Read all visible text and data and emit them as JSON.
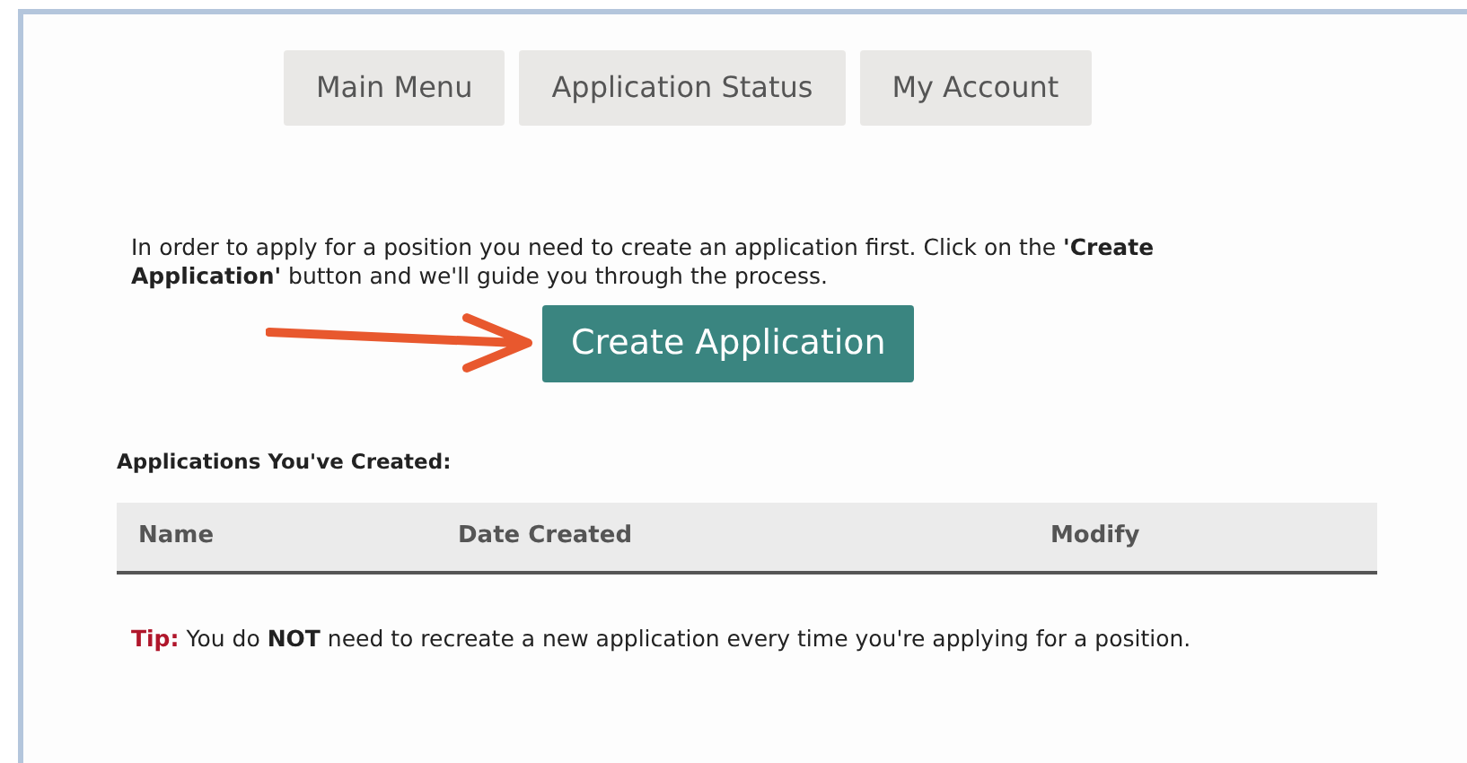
{
  "nav": [
    {
      "label": "Main Menu"
    },
    {
      "label": "Application Status"
    },
    {
      "label": "My Account"
    }
  ],
  "intro": "In order to apply for a position you need to create an application first. Click on the **'Create Application'** button and we'll guide you through the process.",
  "create_button": "Create Application",
  "applications_heading": "Applications You've Created:",
  "table": {
    "columns": [
      "Name",
      "Date Created",
      "Modify"
    ]
  },
  "tip": {
    "label": "Tip:",
    "text": "You do **NOT** need to recreate a new application every time you're applying for a position."
  }
}
